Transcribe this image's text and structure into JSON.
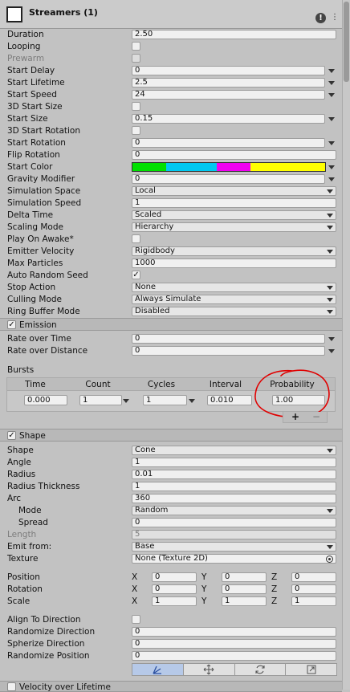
{
  "header": {
    "title": "Streamers (1)",
    "help_glyph": "!"
  },
  "main": {
    "fields": [
      {
        "label": "Duration",
        "type": "text",
        "value": "2.50"
      },
      {
        "label": "Looping",
        "type": "check",
        "checked": false
      },
      {
        "label": "Prewarm",
        "type": "check",
        "checked": false,
        "disabled": true
      },
      {
        "label": "Start Delay",
        "type": "text_arrow",
        "value": "0"
      },
      {
        "label": "Start Lifetime",
        "type": "text_arrow",
        "value": "2.5"
      },
      {
        "label": "Start Speed",
        "type": "text_arrow",
        "value": "24"
      },
      {
        "label": "3D Start Size",
        "type": "check",
        "checked": false
      },
      {
        "label": "Start Size",
        "type": "text_arrow",
        "value": "0.15"
      },
      {
        "label": "3D Start Rotation",
        "type": "check",
        "checked": false
      },
      {
        "label": "Start Rotation",
        "type": "text_arrow",
        "value": "0"
      },
      {
        "label": "Flip Rotation",
        "type": "text",
        "value": "0"
      },
      {
        "label": "Start Color",
        "type": "color"
      },
      {
        "label": "Gravity Modifier",
        "type": "text_arrow",
        "value": "0"
      },
      {
        "label": "Simulation Space",
        "type": "dropdown",
        "value": "Local"
      },
      {
        "label": "Simulation Speed",
        "type": "text",
        "value": "1"
      },
      {
        "label": "Delta Time",
        "type": "dropdown",
        "value": "Scaled"
      },
      {
        "label": "Scaling Mode",
        "type": "dropdown",
        "value": "Hierarchy"
      },
      {
        "label": "Play On Awake*",
        "type": "check",
        "checked": false
      },
      {
        "label": "Emitter Velocity",
        "type": "dropdown",
        "value": "Rigidbody"
      },
      {
        "label": "Max Particles",
        "type": "text",
        "value": "1000"
      },
      {
        "label": "Auto Random Seed",
        "type": "check",
        "checked": true
      },
      {
        "label": "Stop Action",
        "type": "dropdown",
        "value": "None"
      },
      {
        "label": "Culling Mode",
        "type": "dropdown",
        "value": "Always Simulate"
      },
      {
        "label": "Ring Buffer Mode",
        "type": "dropdown",
        "value": "Disabled"
      }
    ],
    "start_color_segments": [
      {
        "color": "#00e000"
      },
      {
        "color": "#00c8f0"
      },
      {
        "color": "#f000f0"
      },
      {
        "color": "#ffff00"
      }
    ]
  },
  "emission": {
    "title": "Emission",
    "enabled": true,
    "fields": [
      {
        "label": "Rate over Time",
        "value": "0"
      },
      {
        "label": "Rate over Distance",
        "value": "0"
      }
    ],
    "bursts_label": "Bursts",
    "bursts_headers": [
      "Time",
      "Count",
      "Cycles",
      "Interval",
      "Probability"
    ],
    "bursts_row": {
      "time": "0.000",
      "count": "1",
      "cycles": "1",
      "interval": "0.010",
      "probability": "1.00"
    },
    "add_glyph": "+",
    "remove_glyph": "−"
  },
  "shape": {
    "title": "Shape",
    "enabled": true,
    "fields": [
      {
        "label": "Shape",
        "type": "dropdown",
        "value": "Cone"
      },
      {
        "label": "Angle",
        "type": "text",
        "value": "1"
      },
      {
        "label": "Radius",
        "type": "text",
        "value": "0.01"
      },
      {
        "label": "Radius Thickness",
        "type": "text",
        "value": "1"
      },
      {
        "label": "Arc",
        "type": "text",
        "value": "360"
      },
      {
        "label": "Mode",
        "type": "dropdown",
        "value": "Random",
        "indent": true
      },
      {
        "label": "Spread",
        "type": "text",
        "value": "0",
        "indent": true
      },
      {
        "label": "Length",
        "type": "text",
        "value": "5",
        "disabled": true
      },
      {
        "label": "Emit from:",
        "type": "dropdown",
        "value": "Base"
      },
      {
        "label": "Texture",
        "type": "object",
        "value": "None (Texture 2D)"
      }
    ],
    "transform": [
      {
        "label": "Position",
        "x": "0",
        "y": "0",
        "z": "0"
      },
      {
        "label": "Rotation",
        "x": "0",
        "y": "0",
        "z": "0"
      },
      {
        "label": "Scale",
        "x": "1",
        "y": "1",
        "z": "1"
      }
    ],
    "axis_labels": {
      "x": "X",
      "y": "Y",
      "z": "Z"
    },
    "bottom_fields": [
      {
        "label": "Align To Direction",
        "type": "check",
        "checked": false
      },
      {
        "label": "Randomize Direction",
        "type": "text",
        "value": "0"
      },
      {
        "label": "Spherize Direction",
        "type": "text",
        "value": "0"
      },
      {
        "label": "Randomize Position",
        "type": "text",
        "value": "0"
      }
    ],
    "toolbar_icons": [
      "edit-shape-icon",
      "move-icon",
      "rotate-icon",
      "scale-icon"
    ]
  },
  "velocity": {
    "title": "Velocity over Lifetime",
    "enabled": false
  }
}
